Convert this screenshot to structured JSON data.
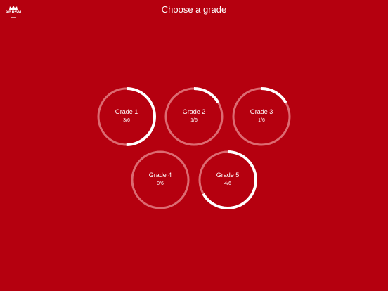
{
  "brand": {
    "name": "ABRSM"
  },
  "header": {
    "title": "Choose a grade"
  },
  "colors": {
    "background": "#b5000f",
    "ring_track": "#dc6b72",
    "ring_progress": "#ffffff"
  },
  "grades": [
    {
      "label": "Grade 1",
      "progress_text": "3/6",
      "completed": 3,
      "total": 6
    },
    {
      "label": "Grade 2",
      "progress_text": "1/6",
      "completed": 1,
      "total": 6
    },
    {
      "label": "Grade 3",
      "progress_text": "1/6",
      "completed": 1,
      "total": 6
    },
    {
      "label": "Grade 4",
      "progress_text": "0/6",
      "completed": 0,
      "total": 6
    },
    {
      "label": "Grade 5",
      "progress_text": "4/6",
      "completed": 4,
      "total": 6
    }
  ]
}
